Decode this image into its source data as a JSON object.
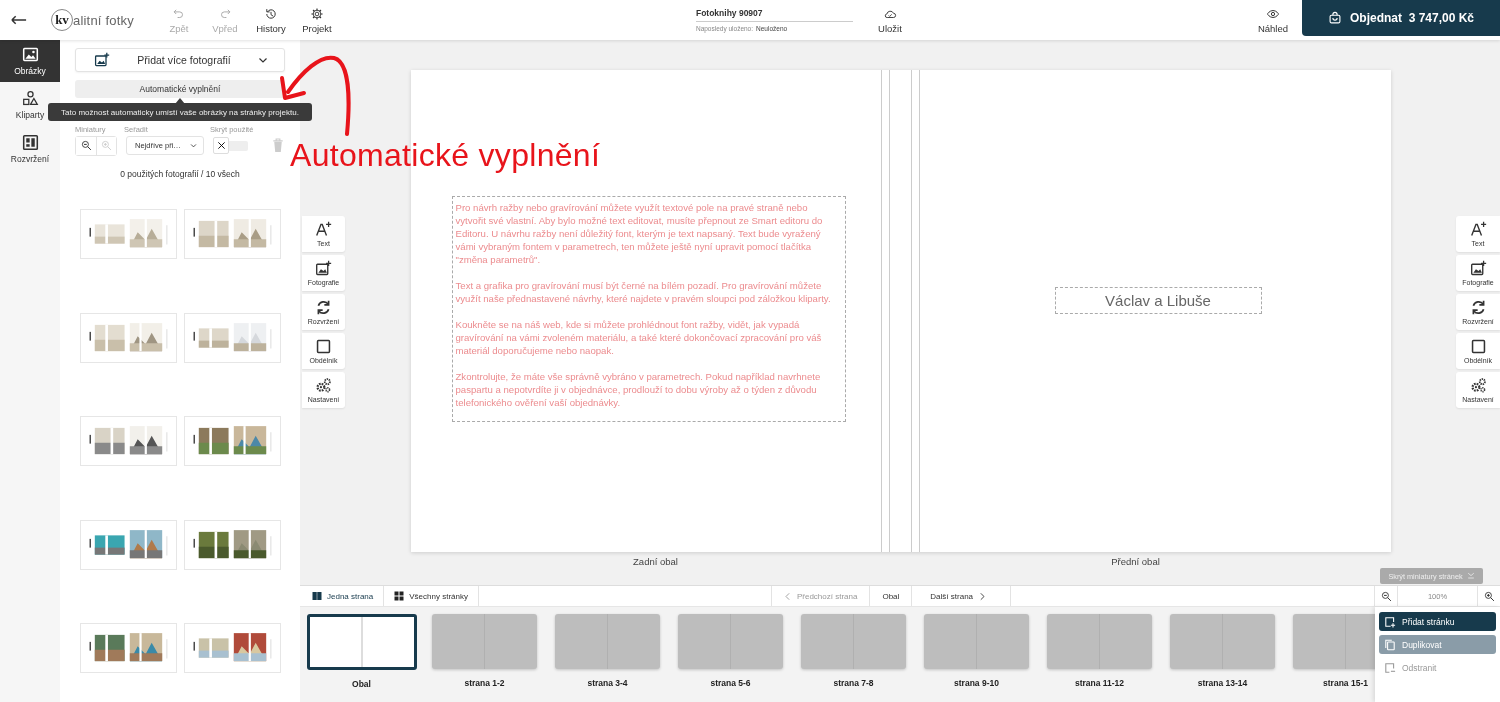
{
  "header": {
    "logo_mark": "kv",
    "logo_text": "alitní fotky",
    "actions": [
      {
        "label": "Zpět",
        "kind": "undo",
        "disabled": true
      },
      {
        "label": "Vpřed",
        "kind": "redo",
        "disabled": true
      },
      {
        "label": "History",
        "kind": "history",
        "disabled": false
      },
      {
        "label": "Projekt",
        "kind": "settings",
        "disabled": false
      }
    ],
    "document": {
      "title": "Fotoknihy 90907",
      "saved_label": "Naposledy uloženo:",
      "saved_value": "Neuloženo"
    },
    "save": {
      "label": "Uložit"
    },
    "preview": {
      "label": "Náhled"
    },
    "order": {
      "label": "Objednat",
      "price": "3 747,00 Kč"
    }
  },
  "rail": [
    {
      "label": "Obrázky",
      "kind": "images",
      "selected": true
    },
    {
      "label": "Kliparty",
      "kind": "shapes",
      "selected": false
    },
    {
      "label": "Rozvržení",
      "kind": "layout",
      "selected": false
    }
  ],
  "panel": {
    "add_photos": "Přidat více fotografií",
    "autofill": "Automatické vyplnění",
    "tooltip": "Tato možnost automaticky umístí vaše obrázky na stránky projektu.",
    "thumb_size": {
      "label": "Miniatury",
      "zoom_out_disabled": false,
      "zoom_in_disabled": true
    },
    "sort": {
      "label": "Seřadit",
      "value": "Nejdříve při…"
    },
    "hide_used": {
      "label": "Skrýt použité",
      "on": false
    },
    "count": "0 použitých fotografií / 10 všech"
  },
  "annotation": {
    "text": "Automatické vyplnění"
  },
  "tools_left": [
    {
      "label": "Text",
      "kind": "text"
    },
    {
      "label": "Fotografie"
    },
    {
      "label": "Rozvržení",
      "kind": "refresh"
    },
    {
      "label": "Obdélník",
      "kind": "rectangle"
    },
    {
      "label": "Nastavení",
      "kind": "gears"
    }
  ],
  "spread": {
    "back_paragraphs": [
      "Pro návrh ražby nebo gravírování můžete využít textové pole na pravé straně nebo vytvořit své vlastní. Aby bylo možné text editovat, musíte přepnout ze Smart editoru do Editoru. U návrhu ražby není důležitý font, kterým je text napsaný. Text bude vyražený vámi vybraným fontem v parametrech, ten můžete ještě nyní upravit pomocí tlačítka \"změna parametrů\".",
      "Text a grafika pro gravírování musí být černé na bílém pozadí. Pro gravírování můžete využít naše přednastavené návrhy, které najdete v pravém sloupci pod záložkou kliparty.",
      "Koukněte se na náš web, kde si můžete prohlédnout font ražby, vidět, jak vypadá gravírování na vámi zvoleném materiálu, a také které dokončovací zpracování pro váš materiál doporučujeme nebo naopak.",
      "Zkontrolujte, že máte vše správně vybráno v parametrech. Pokud například navrhnete paspartu a nepotvrdíte ji v objednávce, prodlouží to dobu výroby až o týden z důvodu telefonického ověření vaší objednávky."
    ],
    "front_title": "Václav a Libuše",
    "back_label": "Zadní obal",
    "front_label": "Přední obal"
  },
  "tools_right": [
    {
      "label": "Text",
      "kind": "text"
    },
    {
      "label": "Fotografie"
    },
    {
      "label": "Rozvržení",
      "kind": "refresh"
    },
    {
      "label": "Obdélník",
      "kind": "rectangle"
    },
    {
      "label": "Nastavení",
      "kind": "gears"
    }
  ],
  "hide_thumbnails": {
    "label": "Skrýt miniatury stránek"
  },
  "view_modes": [
    {
      "label": "Jedna strana",
      "kind": "single",
      "selected": true
    },
    {
      "label": "Všechny stránky",
      "kind": "grid",
      "selected": false
    }
  ],
  "page_nav": {
    "previous": {
      "label": "Předchozí strana",
      "disabled": true
    },
    "current": "Obal",
    "next": {
      "label": "Další strana",
      "disabled": false
    }
  },
  "zoom": {
    "value": "100%"
  },
  "pages": [
    {
      "label": "Obal",
      "selected": true
    },
    {
      "label": "strana 1-2",
      "selected": false
    },
    {
      "label": "strana 3-4",
      "selected": false
    },
    {
      "label": "strana 5-6",
      "selected": false
    },
    {
      "label": "strana 7-8",
      "selected": false
    },
    {
      "label": "strana 9-10",
      "selected": false
    },
    {
      "label": "strana 11-12",
      "selected": false
    },
    {
      "label": "strana 13-14",
      "selected": false
    },
    {
      "label": "strana 15-1",
      "selected": false
    }
  ],
  "page_menu": [
    {
      "label": "Přidat stránku",
      "kind": "add",
      "disabled": false
    },
    {
      "label": "Duplikovat",
      "kind": "duplicate",
      "disabled": true
    },
    {
      "label": "Odstranit",
      "kind": "remove",
      "disabled": true
    }
  ]
}
